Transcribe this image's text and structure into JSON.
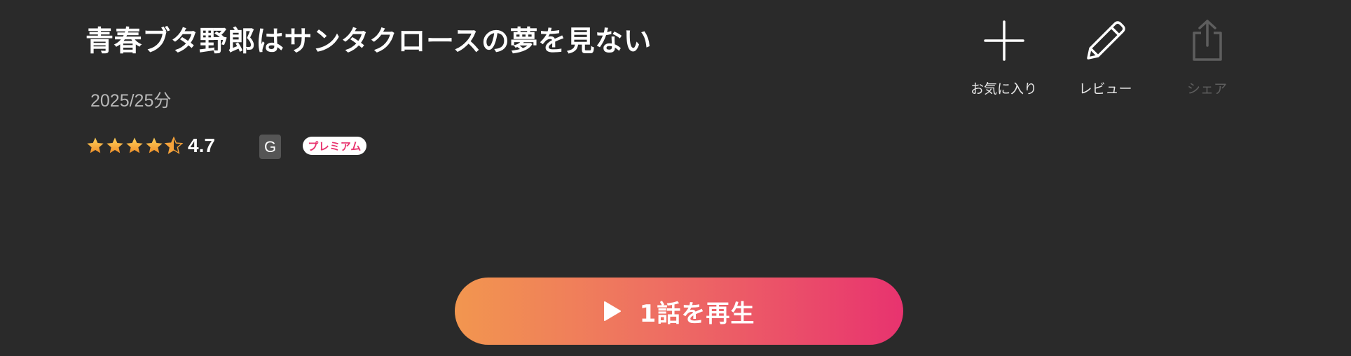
{
  "title": "青春ブタ野郎はサンタクロースの夢を見ない",
  "meta": "2025/25分",
  "rating": {
    "value": "4.7",
    "stars": 4.5,
    "star_color": "#f7a53a"
  },
  "badges": {
    "age": "G",
    "premium": "プレミアム"
  },
  "actions": [
    {
      "label": "お気に入り",
      "icon": "plus-icon",
      "enabled": true
    },
    {
      "label": "レビュー",
      "icon": "pencil-icon",
      "enabled": true
    },
    {
      "label": "シェア",
      "icon": "share-icon",
      "enabled": false
    }
  ],
  "play": {
    "label": "1話を再生",
    "icon": "play-icon",
    "gradient": [
      "#f2964f",
      "#e8336f"
    ]
  },
  "colors": {
    "background": "#2a2a2a",
    "premium_text": "#e8336e"
  }
}
